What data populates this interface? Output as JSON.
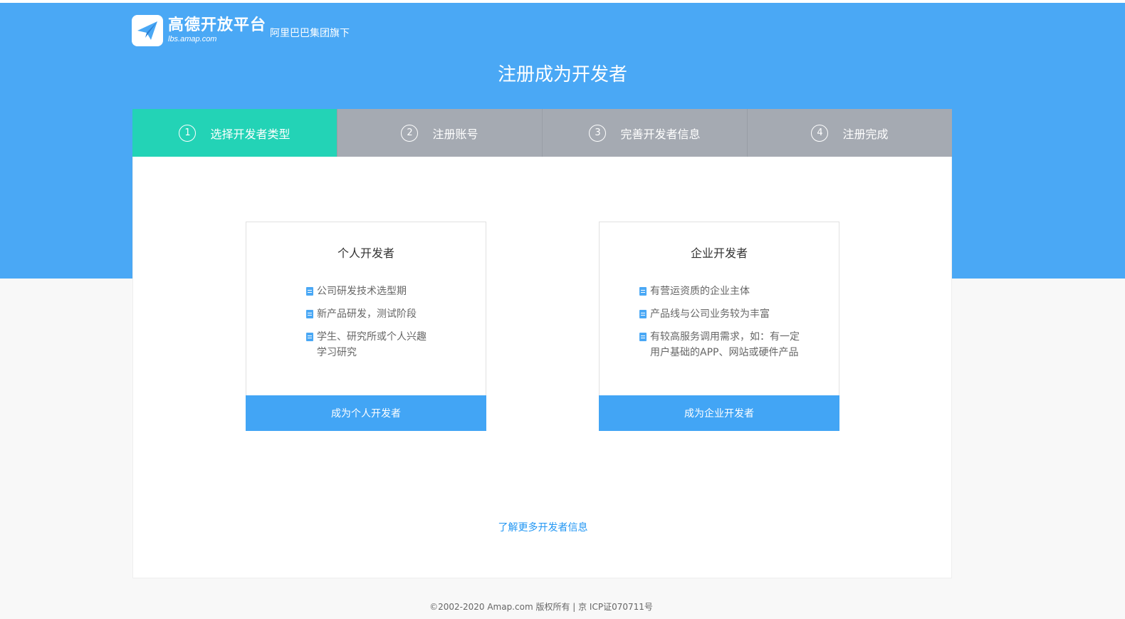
{
  "header": {
    "logo_name": "高德开放平台",
    "logo_url": "lbs.amap.com",
    "logo_subtitle": "阿里巴巴集团旗下",
    "page_title": "注册成为开发者"
  },
  "steps": [
    {
      "num": "1",
      "label": "选择开发者类型",
      "active": true
    },
    {
      "num": "2",
      "label": "注册账号",
      "active": false
    },
    {
      "num": "3",
      "label": "完善开发者信息",
      "active": false
    },
    {
      "num": "4",
      "label": "注册完成",
      "active": false
    }
  ],
  "cards": {
    "personal": {
      "title": "个人开发者",
      "items": [
        "公司研发技术选型期",
        "新产品研发，测试阶段",
        "学生、研究所或个人兴趣学习研究"
      ],
      "button": "成为个人开发者"
    },
    "enterprise": {
      "title": "企业开发者",
      "items": [
        "有营运资质的企业主体",
        "产品线与公司业务较为丰富",
        "有较高服务调用需求，如：有一定用户基础的APP、网站或硬件产品"
      ],
      "button": "成为企业开发者"
    }
  },
  "more_link": "了解更多开发者信息",
  "footer": "©2002-2020 Amap.com 版权所有 | 京 ICP证070711号",
  "colors": {
    "hero_bg": "#4aa8f5",
    "step_active": "#23d3b6",
    "step_inactive": "#a5aab2",
    "button_bg": "#42a5f5",
    "link": "#2196f3"
  }
}
